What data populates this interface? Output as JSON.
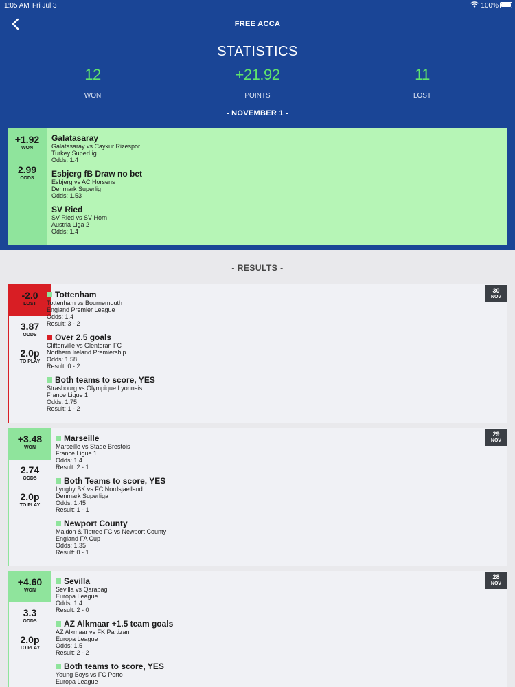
{
  "status_bar": {
    "time": "1:05 AM",
    "date": "Fri Jul 3",
    "battery": "100%"
  },
  "nav": {
    "title": "FREE ACCA"
  },
  "stats": {
    "title": "STATISTICS",
    "won_value": "12",
    "won_label": "WON",
    "points_value": "+21.92",
    "points_label": "POINTS",
    "lost_value": "11",
    "lost_label": "LOST"
  },
  "current": {
    "date_heading": "- NOVEMBER 1 -",
    "result_value": "+1.92",
    "result_label": "WON",
    "odds_value": "2.99",
    "odds_label": "ODDS",
    "bets": [
      {
        "title": "Galatasaray",
        "match": "Galatasaray vs Caykur Rizespor",
        "league": "Turkey SuperLig",
        "odds": "Odds: 1.4"
      },
      {
        "title": "Esbjerg fB Draw no bet",
        "match": "Esbjerg vs AC Horsens",
        "league": "Denmark Superlig",
        "odds": "Odds: 1.53"
      },
      {
        "title": "SV Ried",
        "match": "SV Ried vs SV Horn",
        "league": "Austria Liga 2",
        "odds": "Odds: 1.4"
      }
    ]
  },
  "results_heading": "- RESULTS -",
  "results": [
    {
      "result_value": "-2.0",
      "result_label": "LOST",
      "odds_value": "3.87",
      "odds_label": "ODDS",
      "play_value": "2.0p",
      "play_label": "TO PLAY",
      "day": "30",
      "month": "NOV",
      "bets": [
        {
          "status": "won",
          "title": "Tottenham",
          "match": "Tottenham vs Bournemouth",
          "league": "England Premier League",
          "odds": "Odds: 1.4",
          "result": "Result: 3 - 2"
        },
        {
          "status": "lost",
          "title": "Over 2.5 goals",
          "match": "Cliftonville vs Glentoran FC",
          "league": "Northern Ireland Premiership",
          "odds": "Odds: 1.58",
          "result": "Result: 0 - 2"
        },
        {
          "status": "won",
          "title": "Both teams to score, YES",
          "match": "Strasbourg vs Olympique Lyonnais",
          "league": "France Ligue 1",
          "odds": "Odds: 1.75",
          "result": "Result: 1 - 2"
        }
      ]
    },
    {
      "result_value": "+3.48",
      "result_label": "WON",
      "odds_value": "2.74",
      "odds_label": "ODDS",
      "play_value": "2.0p",
      "play_label": "TO PLAY",
      "day": "29",
      "month": "NOV",
      "bets": [
        {
          "status": "won",
          "title": "Marseille",
          "match": "Marseille vs Stade Brestois",
          "league": "France Ligue 1",
          "odds": "Odds: 1.4",
          "result": "Result: 2 - 1"
        },
        {
          "status": "won",
          "title": "Both Teams to score, YES",
          "match": "Lyngby BK vs FC Nordsjaelland",
          "league": "Denmark Superliga",
          "odds": "Odds: 1.45",
          "result": "Result: 1 - 1"
        },
        {
          "status": "won",
          "title": "Newport County",
          "match": "Maldon & Tiptree FC vs Newport County",
          "league": "England FA Cup",
          "odds": "Odds: 1.35",
          "result": "Result: 0 - 1"
        }
      ]
    },
    {
      "result_value": "+4.60",
      "result_label": "WON",
      "odds_value": "3.3",
      "odds_label": "ODDS",
      "play_value": "2.0p",
      "play_label": "TO PLAY",
      "day": "28",
      "month": "NOV",
      "bets": [
        {
          "status": "won",
          "title": "Sevilla",
          "match": "Sevilla vs Qarabag",
          "league": "Europa League",
          "odds": "Odds: 1.4",
          "result": "Result: 2 - 0"
        },
        {
          "status": "won",
          "title": "AZ Alkmaar +1.5 team goals",
          "match": "AZ Alkmaar vs FK Partizan",
          "league": "Europa League",
          "odds": "Odds: 1.5",
          "result": "Result: 2 - 2"
        },
        {
          "status": "won",
          "title": "Both teams to score, YES",
          "match": "Young Boys vs FC Porto",
          "league": "Europa League",
          "odds": "",
          "result": ""
        }
      ]
    }
  ]
}
